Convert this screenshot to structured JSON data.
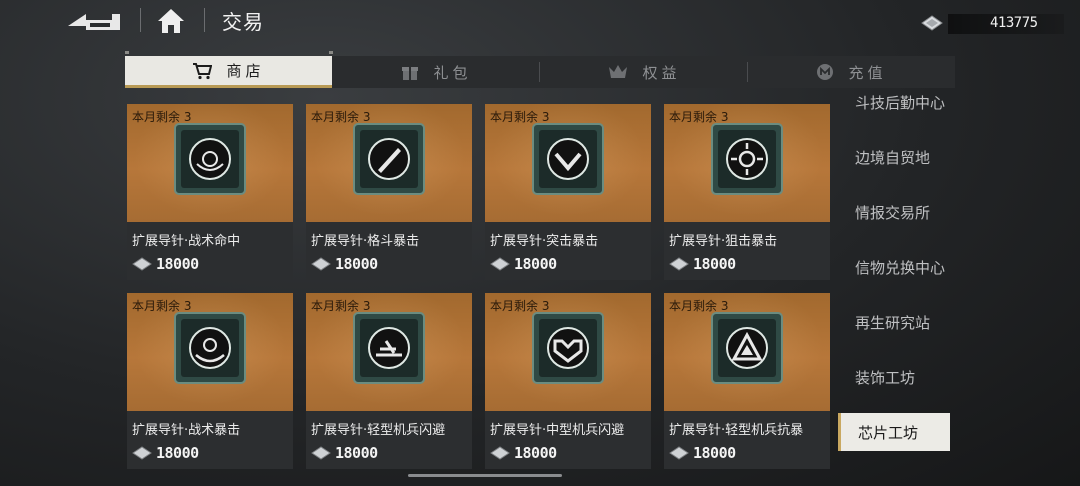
{
  "header": {
    "title": "交易",
    "back_icon": "back-arrow-icon",
    "home_icon": "home-icon",
    "currency": {
      "icon": "crystal-gem-icon",
      "amount": "413775"
    }
  },
  "tabs": [
    {
      "label": "商店",
      "icon": "cart-icon",
      "active": true
    },
    {
      "label": "礼包",
      "icon": "gift-icon",
      "active": false
    },
    {
      "label": "权益",
      "icon": "crown-icon",
      "active": false
    },
    {
      "label": "充值",
      "icon": "coin-icon",
      "active": false
    }
  ],
  "items": [
    {
      "quota": "本月剩余 3",
      "name": "扩展导针·战术命中",
      "price": "18000",
      "emblem": "target-swirl"
    },
    {
      "quota": "本月剩余 3",
      "name": "扩展导针·格斗暴击",
      "price": "18000",
      "emblem": "blade"
    },
    {
      "quota": "本月剩余 3",
      "name": "扩展导针·突击暴击",
      "price": "18000",
      "emblem": "chevron-burst"
    },
    {
      "quota": "本月剩余 3",
      "name": "扩展导针·狙击暴击",
      "price": "18000",
      "emblem": "crosshair"
    },
    {
      "quota": "本月剩余 3",
      "name": "扩展导针·战术暴击",
      "price": "18000",
      "emblem": "swirl"
    },
    {
      "quota": "本月剩余 3",
      "name": "扩展导针·轻型机兵闪避",
      "price": "18000",
      "emblem": "dash"
    },
    {
      "quota": "本月剩余 3",
      "name": "扩展导针·中型机兵闪避",
      "price": "18000",
      "emblem": "shield-m"
    },
    {
      "quota": "本月剩余 3",
      "name": "扩展导针·轻型机兵抗暴",
      "price": "18000",
      "emblem": "triangle"
    }
  ],
  "sidenav": [
    {
      "label": "斗技后勤中心",
      "active": false
    },
    {
      "label": "边境自贸地",
      "active": false
    },
    {
      "label": "情报交易所",
      "active": false
    },
    {
      "label": "信物兑换中心",
      "active": false
    },
    {
      "label": "再生研究站",
      "active": false
    },
    {
      "label": "装饰工坊",
      "active": false
    },
    {
      "label": "芯片工坊",
      "active": true
    }
  ]
}
